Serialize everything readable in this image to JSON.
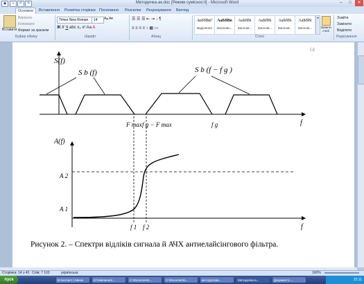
{
  "window": {
    "title": "Методичка-ак.doc [Режим сумісності] - Microsoft Word",
    "minimize": "–",
    "maximize": "□",
    "close": "✕"
  },
  "tabs": [
    "Основне",
    "Вставлення",
    "Розмітка сторінки",
    "Посилання",
    "Розсилки",
    "Рецензування",
    "Вигляд"
  ],
  "ribbon": {
    "paste": "Вставити",
    "cut": "Вирізати",
    "copy": "Копіювати",
    "format_painter": "Формат за зразком",
    "clipboard_group": "Буфер обміну",
    "font_name": "Times New Roman",
    "font_size": "14",
    "font_group": "Шрифт",
    "paragraph_group": "Абзац",
    "styles_group": "Стилі",
    "styles": [
      {
        "sample": "АаБбВвГ",
        "name": "Виділення"
      },
      {
        "sample": "АаБбВв",
        "name": "Заголово..."
      },
      {
        "sample": "АаБбВі",
        "name": "Заголов..."
      },
      {
        "sample": "АаБбВі",
        "name": "Заголов..."
      },
      {
        "sample": "АаБбВі",
        "name": "Заголов..."
      },
      {
        "sample": "АаБбВі",
        "name": "Заголов..."
      }
    ],
    "change_styles": "Змінити стилі",
    "find": "Знайти",
    "replace": "Замінити",
    "select": "Виділити",
    "editing_group": "Редагування"
  },
  "document": {
    "page_number": "14",
    "caption": "Рисунок 2. – Спектри відліків сигнала й АЧХ антиелайсінгового фільтра.",
    "top_graph": {
      "y_label": "S(f)",
      "spectrum_label_1": "S b (f)",
      "spectrum_label_2": "S b (f − f g )",
      "tick_fmax": "F max",
      "tick_fg_minus": "f g − F max",
      "tick_fg": "f g",
      "x_label": "f"
    },
    "bottom_graph": {
      "y_label": "A(f)",
      "a2": "A 2",
      "a1": "A 1",
      "f1": "f 1",
      "f2": "f 2",
      "x_label": "f"
    }
  },
  "status": {
    "page": "Сторінка: 14 з 43",
    "words": "Слів: 7 103",
    "language": "українська",
    "zoom": "160%"
  },
  "taskbar": {
    "start": "пуск",
    "tasks": [
      "В Контакті | Меню",
      "Е:\\Навчання\\...",
      "C:\\Documents...",
      "C:\\Documents...",
      "мої курсова...",
      "Методичка-а...",
      "Документ1 -..."
    ],
    "clock": "22:11"
  }
}
